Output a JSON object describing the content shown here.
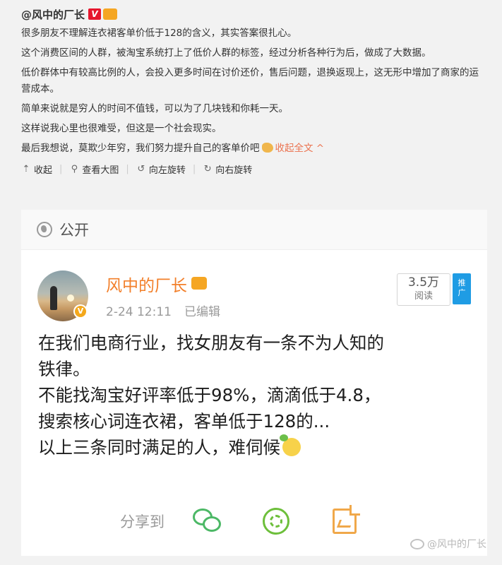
{
  "post": {
    "author": "@风中的厂长",
    "badge_v": "V",
    "paragraphs": [
      "很多朋友不理解连衣裙客单价低于128的含义，其实答案很扎心。",
      "这个消费区间的人群，被淘宝系统打上了低价人群的标签，经过分析各种行为后，做成了大数据。",
      "低价群体中有较高比例的人，会投入更多时间在讨价还价，售后问题，退换返现上，这无形中增加了商家的运营成本。",
      "简单来说就是穷人的时间不值钱，可以为了几块钱和你耗一天。",
      "这样说我心里也很难受，但这是一个社会现实。"
    ],
    "last_paragraph": "最后我想说，莫欺少年穷，我们努力提升自己的客单价吧",
    "collapse_label": "收起全文",
    "collapse_icon": "^",
    "toolbar": {
      "collapse": "收起",
      "view_large": "查看大图",
      "rotate_left": "向左旋转",
      "rotate_right": "向右旋转"
    }
  },
  "card": {
    "visibility": "公开",
    "username": "风中的厂长",
    "avatar_badge": "V",
    "date": "2-24 12:11",
    "edited": "已编辑",
    "reads_count": "3.5万",
    "reads_label": "阅读",
    "promo_label_1": "推",
    "promo_label_2": "广",
    "lines": [
      "在我们电商行业，找女朋友有一条不为人知的",
      "铁律。",
      "不能找淘宝好评率低于98%，滴滴低于4.8，",
      "搜索核心词连衣裙，客单低于128的...",
      "以上三条同时满足的人，难伺候"
    ],
    "share_label": "分享到"
  },
  "watermark": "@风中的厂长",
  "icons": {
    "collapse": "arrow-up-icon",
    "view_large": "search-icon",
    "rotate_left": "rotate-left-icon",
    "rotate_right": "rotate-right-icon",
    "globe": "globe-icon",
    "wechat": "wechat-icon",
    "moments": "moments-icon",
    "save": "save-image-icon"
  },
  "colors": {
    "username": "#f27f2a",
    "collapse_link": "#eb7350",
    "promo": "#1f9ce4",
    "wechat": "#4cb866",
    "moments": "#6dbf3b"
  }
}
